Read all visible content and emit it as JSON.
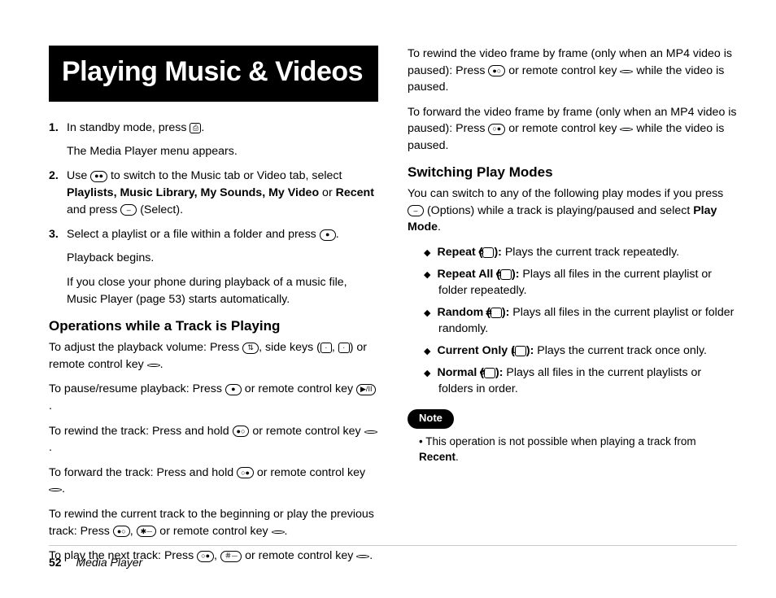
{
  "title": "Playing Music & Videos",
  "steps": [
    {
      "num": "1",
      "main_before": "In standby mode, press ",
      "icon": "⎙",
      "main_after": ".",
      "subs": [
        "The Media Player menu appears."
      ]
    },
    {
      "num": "2",
      "seg_a": "Use ",
      "icon1": "●●",
      "seg_b": " to switch to the Music tab or Video tab, select ",
      "bold_list": "Playlists, Music Library, My Sounds, My Video",
      "or_word": " or ",
      "bold_last": "Recent",
      "seg_c": " and press ",
      "icon2": "–",
      "seg_d": " (Select).",
      "subs": []
    },
    {
      "num": "3",
      "main_before": "Select a playlist or a file within a folder and press ",
      "icon": "●",
      "main_after": ".",
      "subs": [
        "Playback begins.",
        "If you close your phone during playback of a music file, Music Player (page 53) starts automatically."
      ]
    }
  ],
  "ops_heading": "Operations while a Track is Playing",
  "ops": {
    "volume_a": "To adjust the playback volume: Press ",
    "volume_b": ", side keys (",
    "volume_c": ", ",
    "volume_d": ") or remote control key ",
    "volume_e": ".",
    "pause_a": "To pause/resume playback: Press ",
    "pause_b": " or remote control key ",
    "pause_c": ".",
    "rw_a": "To rewind the track: Press and hold ",
    "rw_b": " or remote control key ",
    "rw_c": ".",
    "fw_a": "To forward the track: Press and hold ",
    "fw_b": " or remote control key ",
    "fw_c": ".",
    "prev_a": "To rewind the current track to the beginning or play the previous track: Press ",
    "prev_b": ", ",
    "prev_c": " or remote control key ",
    "prev_d": ".",
    "next_a": "To play the next track: Press ",
    "next_b": ", ",
    "next_c": " or remote control key ",
    "next_d": "."
  },
  "col2": {
    "rw_frame_a": "To rewind the video frame by frame (only when an MP4 video is paused): Press ",
    "rw_frame_b": " or remote control key ",
    "rw_frame_c": " while the video is paused.",
    "fw_frame_a": "To forward the video frame by frame (only when an MP4 video is paused): Press ",
    "fw_frame_b": " or remote control key ",
    "fw_frame_c": " while the video is paused."
  },
  "modes_heading": "Switching Play Modes",
  "modes_intro_a": "You can switch to any of the following play modes if you press ",
  "modes_intro_b": " (Options) while a track is playing/paused and select ",
  "modes_intro_bold": "Play Mode",
  "modes_intro_c": ".",
  "modes": [
    {
      "name": "Repeat",
      "icon": "⥀",
      "desc": " Plays the current track repeatedly."
    },
    {
      "name": "Repeat All",
      "icon": "⥀",
      "desc": " Plays all files in the current playlist or folder repeatedly."
    },
    {
      "name": "Random",
      "icon": "⇄",
      "desc": " Plays all files in the current playlist or folder randomly."
    },
    {
      "name": "Current Only",
      "icon": "1",
      "desc": " Plays the current track once only."
    },
    {
      "name": "Normal",
      "icon": "↺",
      "desc": " Plays all files in the current playlists or folders in order."
    }
  ],
  "note_label": "Note",
  "note_text_a": "This operation is not possible when playing a track from ",
  "note_bold": "Recent",
  "note_text_b": ".",
  "footer": {
    "page": "52",
    "section": "Media Player"
  },
  "icons": {
    "updown": "⇅",
    "sideA": "·",
    "sideB": "·",
    "rc": " ",
    "center": "●",
    "playpause": "▶/II",
    "left": "●○",
    "right": "○●",
    "star": "✱⏤",
    "hash": "＃⏤",
    "softright": "–"
  }
}
